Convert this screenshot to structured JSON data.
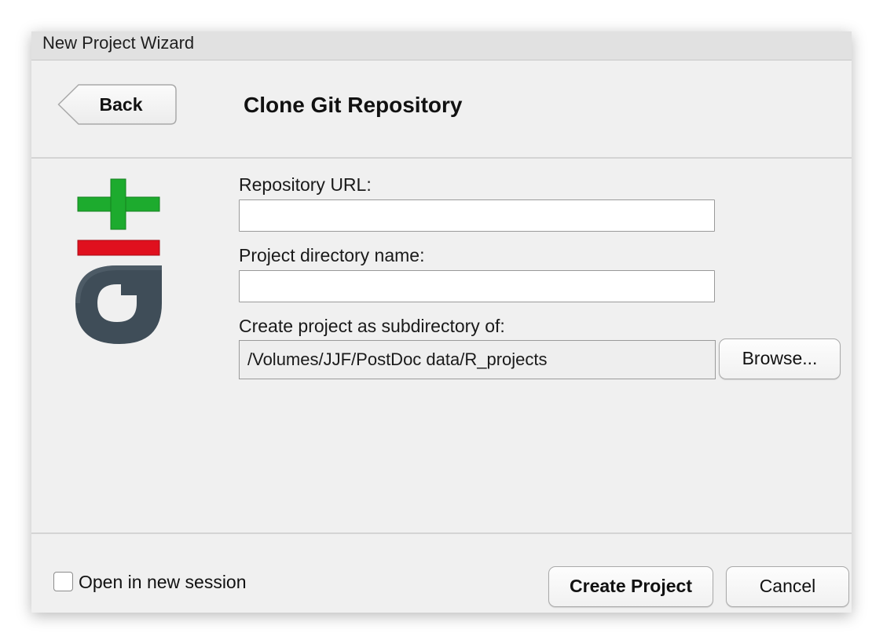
{
  "window": {
    "title": "New Project Wizard"
  },
  "header": {
    "back_label": "Back",
    "page_title": "Clone Git Repository"
  },
  "logo": {
    "icon": "git-logo-icon",
    "colors": {
      "plus": "#1dab2e",
      "minus": "#e0101e",
      "letter": "#3f4d58"
    }
  },
  "form": {
    "repo_url": {
      "label": "Repository URL:",
      "value": ""
    },
    "project_dir_name": {
      "label": "Project directory name:",
      "value": ""
    },
    "subdirectory": {
      "label": "Create project as subdirectory of:",
      "path": "/Volumes/JJF/PostDoc data/R_projects",
      "browse_label": "Browse..."
    }
  },
  "footer": {
    "open_new_session_label": "Open in new session",
    "open_new_session_checked": false,
    "create_label": "Create Project",
    "cancel_label": "Cancel"
  }
}
